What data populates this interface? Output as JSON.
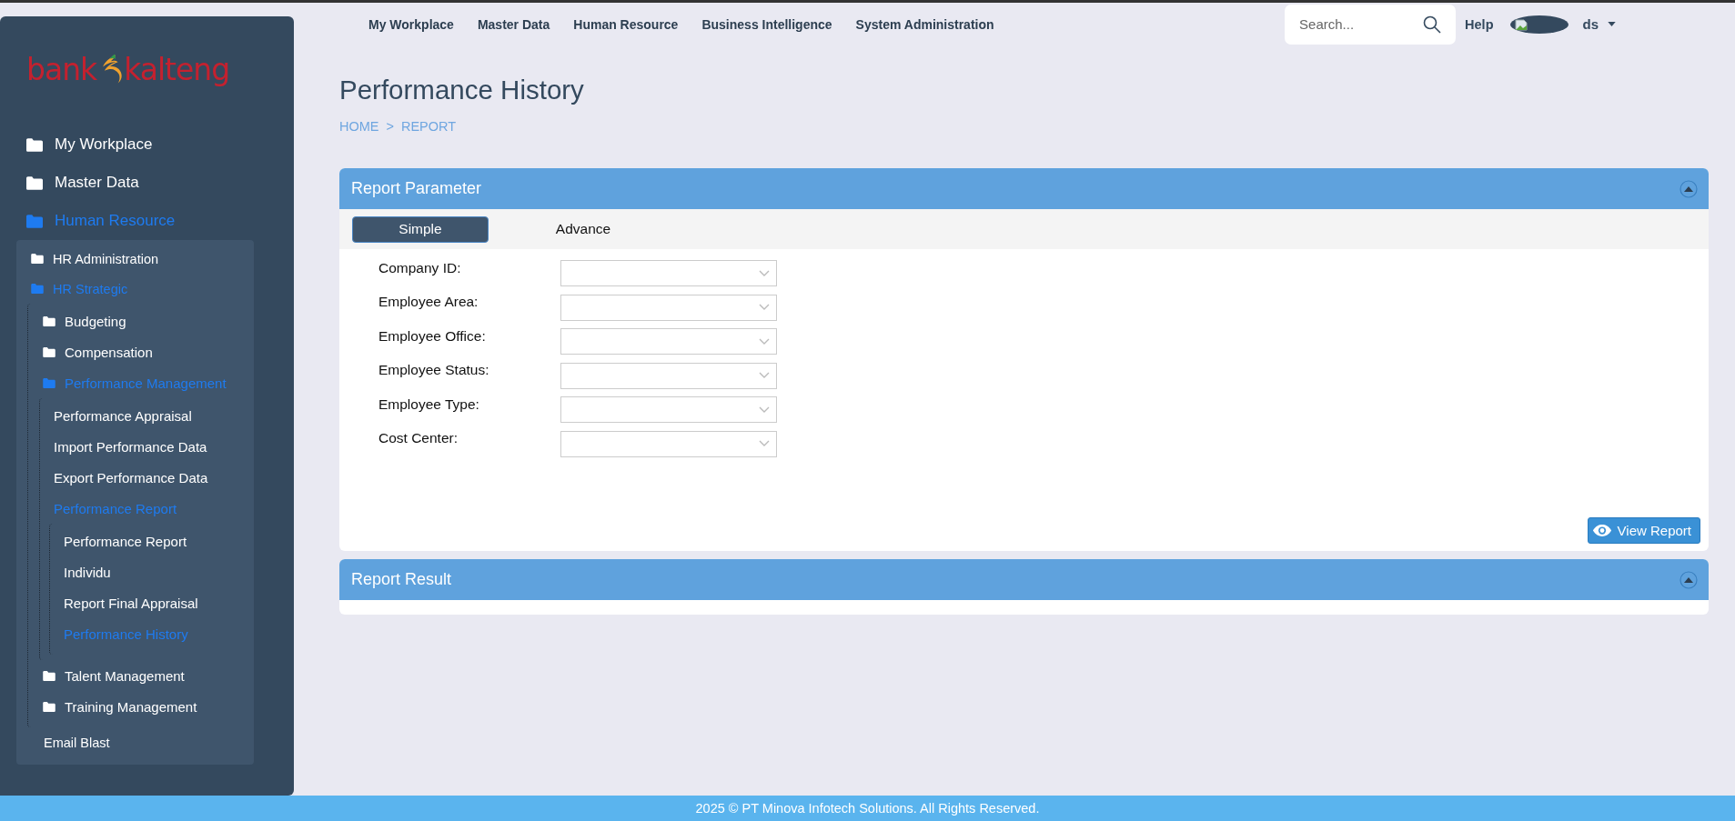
{
  "logo": {
    "left": "bank",
    "right": "kalteng"
  },
  "sidebar": {
    "items": [
      {
        "label": "My Workplace",
        "kind": "folder",
        "active": false
      },
      {
        "label": "Master Data",
        "kind": "folder",
        "active": false
      },
      {
        "label": "Human Resource",
        "kind": "folder",
        "active": true,
        "children": [
          {
            "label": "HR Administration",
            "kind": "folder",
            "active": false
          },
          {
            "label": "HR Strategic",
            "kind": "folder",
            "active": true,
            "children": [
              {
                "label": "Budgeting",
                "kind": "folder",
                "active": false
              },
              {
                "label": "Compensation",
                "kind": "folder",
                "active": false
              },
              {
                "label": "Performance Management",
                "kind": "folder",
                "active": true,
                "children": [
                  {
                    "label": "Performance Appraisal",
                    "kind": "page",
                    "active": false
                  },
                  {
                    "label": "Import Performance Data",
                    "kind": "page",
                    "active": false
                  },
                  {
                    "label": "Export Performance Data",
                    "kind": "page",
                    "active": false
                  },
                  {
                    "label": "Performance Report",
                    "kind": "page",
                    "active": true,
                    "children": [
                      {
                        "label": "Performance Report",
                        "kind": "page",
                        "active": false
                      },
                      {
                        "label": "Individu",
                        "kind": "page",
                        "active": false
                      },
                      {
                        "label": "Report Final Appraisal",
                        "kind": "page",
                        "active": false
                      },
                      {
                        "label": "Performance History",
                        "kind": "page",
                        "active": true
                      }
                    ]
                  }
                ]
              },
              {
                "label": "Talent Management",
                "kind": "folder",
                "active": false
              },
              {
                "label": "Training Management",
                "kind": "folder",
                "active": false
              }
            ]
          },
          {
            "label": "Email Blast",
            "kind": "page",
            "active": false
          }
        ]
      }
    ]
  },
  "top_nav": {
    "links": [
      "My Workplace",
      "Master Data",
      "Human Resource",
      "Business Intelligence",
      "System Administration"
    ]
  },
  "search": {
    "placeholder": "Search..."
  },
  "help": "Help",
  "user": {
    "name": "ds"
  },
  "page": {
    "title": "Performance History",
    "breadcrumb": [
      "HOME",
      "REPORT"
    ],
    "breadcrumb_separator": ">"
  },
  "report_parameter": {
    "title": "Report Parameter",
    "tabs": [
      {
        "label": "Simple",
        "selected": true
      },
      {
        "label": "Advance",
        "selected": false
      }
    ],
    "fields": [
      {
        "label": "Company ID:"
      },
      {
        "label": "Employee Area:"
      },
      {
        "label": "Employee Office:"
      },
      {
        "label": "Employee Status:"
      },
      {
        "label": "Employee Type:"
      },
      {
        "label": "Cost Center:"
      }
    ],
    "button": "View Report"
  },
  "report_result": {
    "title": "Report Result"
  },
  "footer": "2025 © PT Minova Infotech Solutions. All Rights Reserved."
}
